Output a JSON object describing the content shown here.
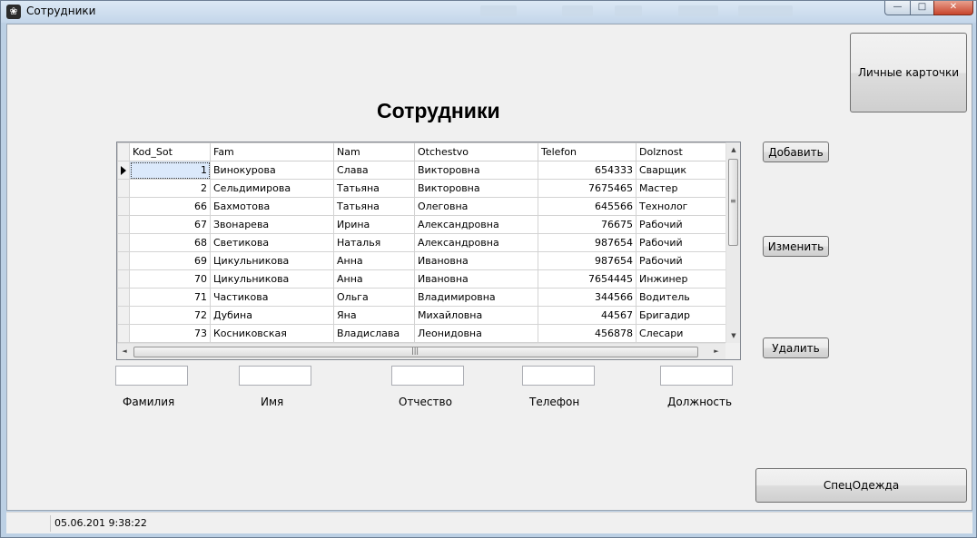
{
  "window": {
    "title": "Сотрудники",
    "app_icon": "paw-icon",
    "controls": {
      "minimize": "—",
      "maximize": "□",
      "close": "✕"
    }
  },
  "main": {
    "heading": "Сотрудники",
    "buttons": {
      "cards": "Личные карточки",
      "add": "Добавить",
      "edit": "Изменить",
      "delete": "Удалить",
      "workwear": "СпецОдежда"
    }
  },
  "grid": {
    "columns": [
      "Kod_Sot",
      "Fam",
      "Nam",
      "Otchestvo",
      "Telefon",
      "Dolznost"
    ],
    "rows": [
      [
        "1",
        "Винокурова",
        "Слава",
        "Викторовна",
        "654333",
        "Сварщик"
      ],
      [
        "2",
        "Сельдимирова",
        "Татьяна",
        "Викторовна",
        "7675465",
        "Мастер"
      ],
      [
        "66",
        "Бахмотова",
        "Татьяна",
        "Олеговна",
        "645566",
        "Технолог"
      ],
      [
        "67",
        "Звонарева",
        "Ирина",
        "Александровна",
        "76675",
        "Рабочий"
      ],
      [
        "68",
        "Светикова",
        "Наталья",
        "Александровна",
        "987654",
        "Рабочий"
      ],
      [
        "69",
        "Цикульникова",
        "Анна",
        "Ивановна",
        "987654",
        "Рабочий"
      ],
      [
        "70",
        "Цикульникова",
        "Анна",
        "Ивановна",
        "7654445",
        "Инжинер"
      ],
      [
        "71",
        "Частикова",
        "Ольга",
        "Владимировна",
        "344566",
        "Водитель"
      ],
      [
        "72",
        "Дубина",
        "Яна",
        "Михайловна",
        "44567",
        "Бригадир"
      ],
      [
        "73",
        "Косниковская",
        "Владислава",
        "Леонидовна",
        "456878",
        "Слесари"
      ]
    ],
    "selected_row": 0
  },
  "form": {
    "fields": [
      {
        "label": "Фамилия",
        "value": ""
      },
      {
        "label": "Имя",
        "value": ""
      },
      {
        "label": "Отчество",
        "value": ""
      },
      {
        "label": "Телефон",
        "value": ""
      },
      {
        "label": "Должность",
        "value": ""
      }
    ]
  },
  "status": {
    "datetime": "05.06.201 9:38:22"
  }
}
